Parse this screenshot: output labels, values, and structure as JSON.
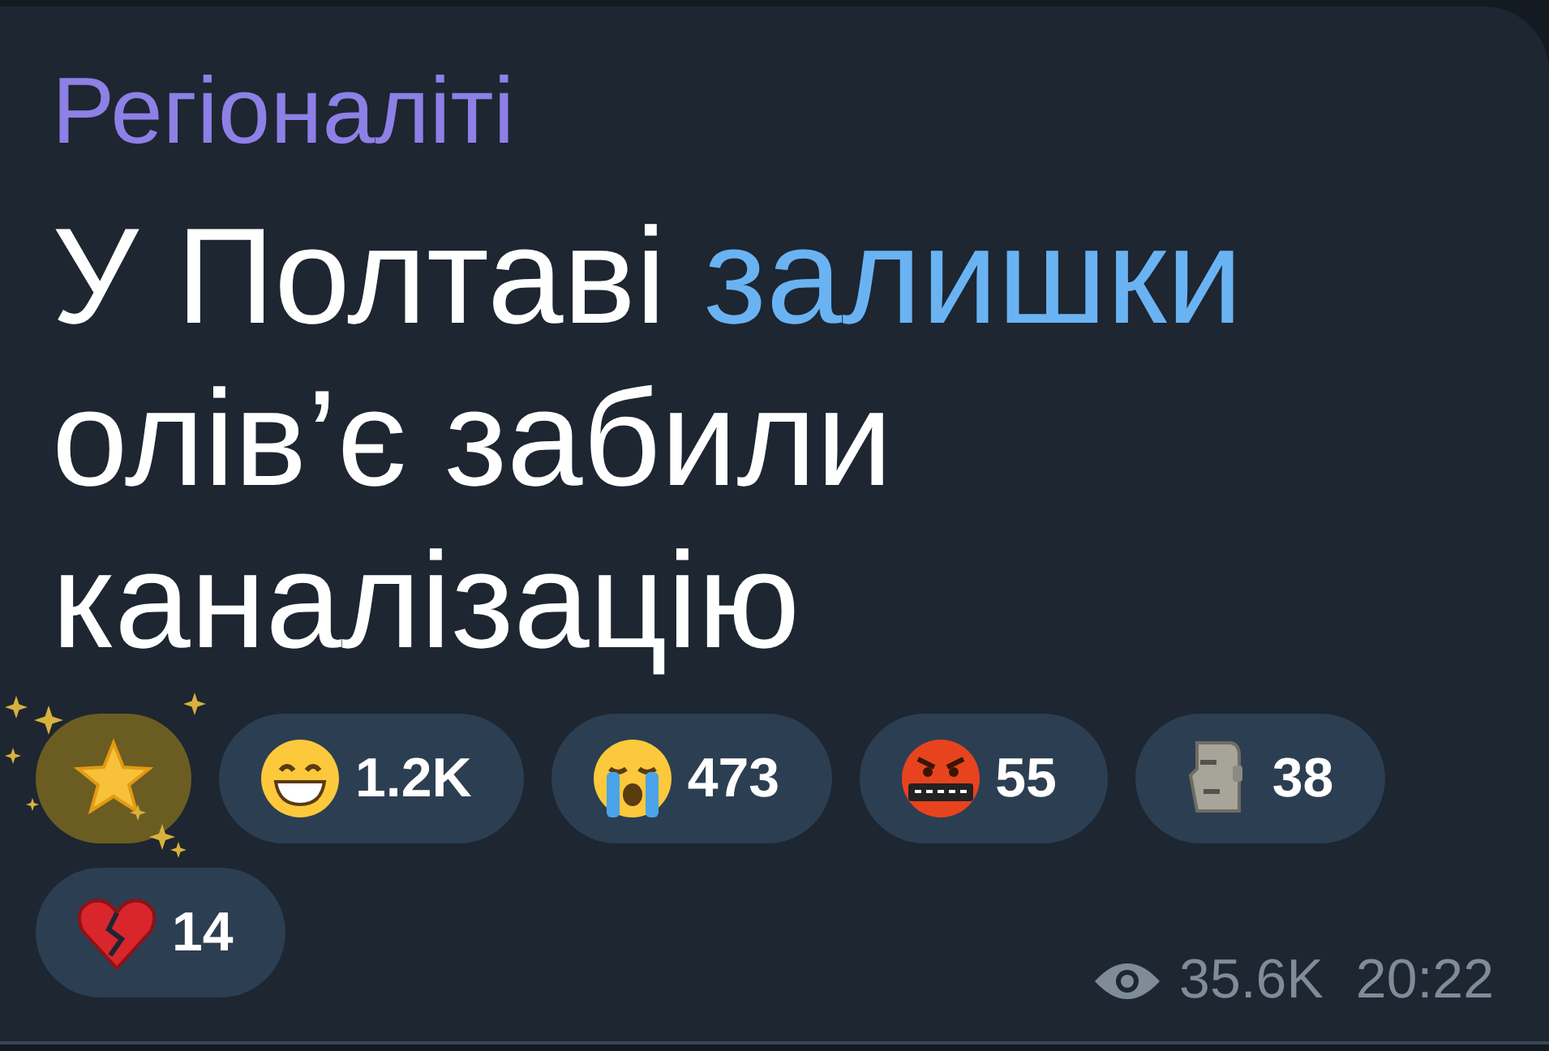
{
  "message": {
    "channel": "Регіоналіті",
    "body": [
      {
        "text": "У Полтаві ",
        "link": false
      },
      {
        "text": "залишки",
        "link": true
      },
      {
        "text": " олів’є забили каналізацію",
        "link": false
      }
    ],
    "reactions": [
      {
        "kind": "star",
        "selected": true
      },
      {
        "kind": "grin",
        "count": "1.2K",
        "selected": false
      },
      {
        "kind": "cry",
        "count": "473",
        "selected": false
      },
      {
        "kind": "curse",
        "count": "55",
        "selected": false
      },
      {
        "kind": "moai",
        "count": "38",
        "selected": false
      },
      {
        "kind": "heart",
        "count": "14",
        "selected": false
      }
    ],
    "views": "35.6K",
    "time": "20:22"
  }
}
